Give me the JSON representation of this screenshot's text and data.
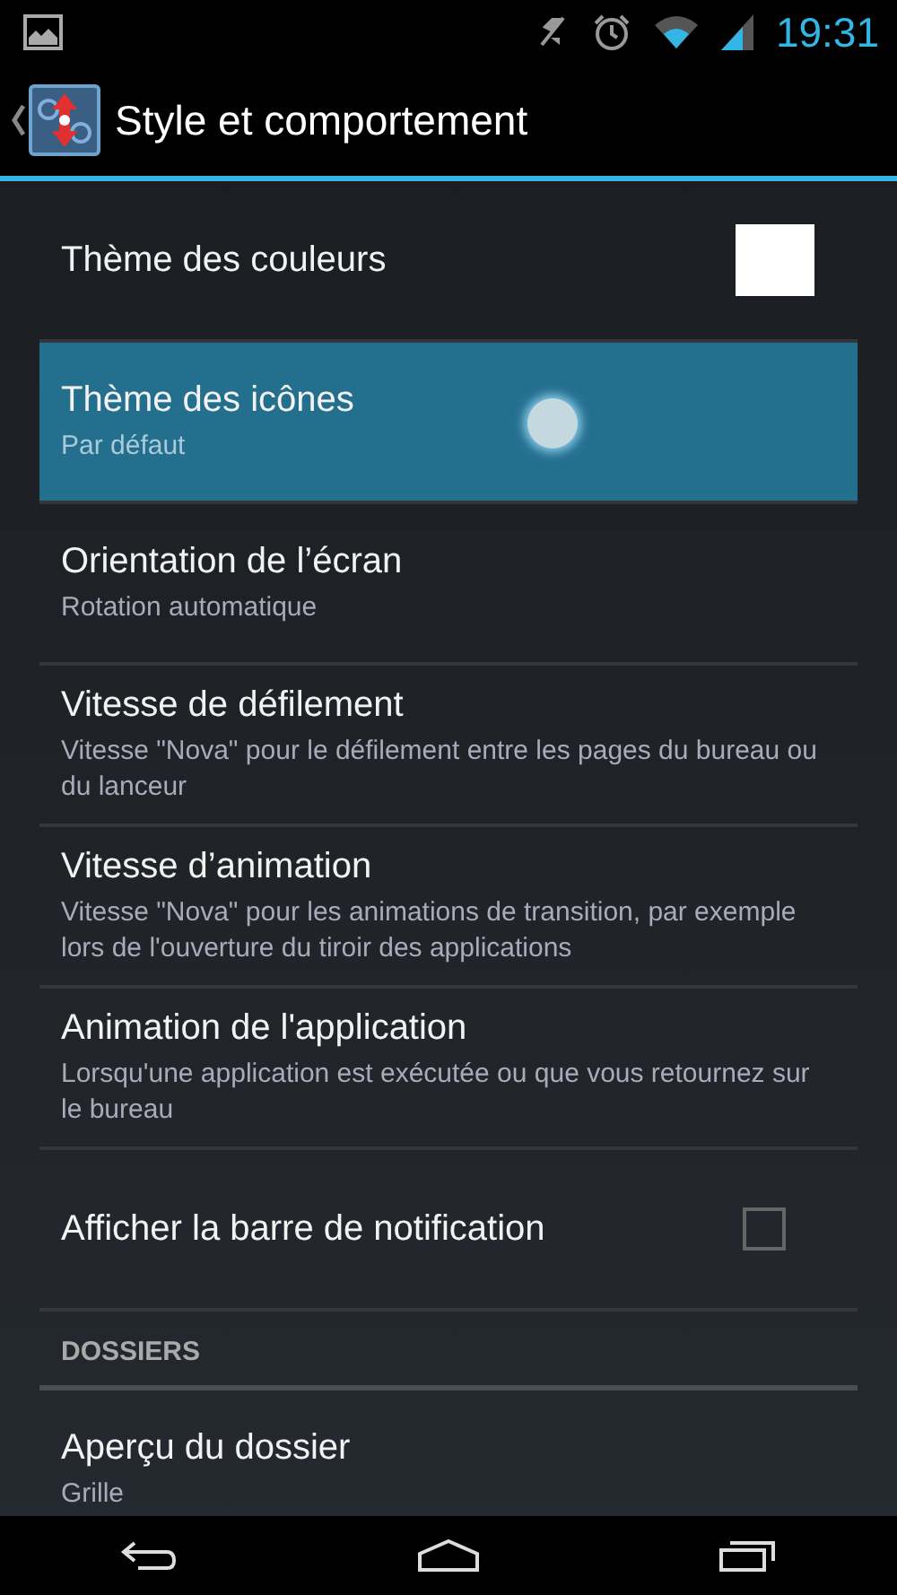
{
  "status_bar": {
    "time": "19:31"
  },
  "action_bar": {
    "title": "Style et comportement"
  },
  "items": [
    {
      "kind": "color",
      "title": "Thème des couleurs",
      "color": "#ffffff",
      "selected": false
    },
    {
      "kind": "list",
      "title": "Thème des icônes",
      "summary": "Par défaut",
      "selected": true
    },
    {
      "kind": "list",
      "title": "Orientation de l’écran",
      "summary": "Rotation automatique",
      "selected": false
    },
    {
      "kind": "list",
      "title": "Vitesse de défilement",
      "summary": "Vitesse \"Nova\" pour le défilement entre les pages du bureau ou du lanceur",
      "selected": false
    },
    {
      "kind": "list",
      "title": "Vitesse d’animation",
      "summary": "Vitesse \"Nova\" pour les animations de transition, par exemple lors de l'ouverture du tiroir des applications",
      "selected": false
    },
    {
      "kind": "list",
      "title": "Animation de l'application",
      "summary": "Lorsqu'une application est exécutée ou que vous retournez sur le bureau",
      "selected": false
    },
    {
      "kind": "checkbox",
      "title": "Afficher la barre de notification",
      "checked": false,
      "selected": false
    },
    {
      "kind": "header",
      "title": "DOSSIERS"
    },
    {
      "kind": "list",
      "title": "Aperçu du dossier",
      "summary": "Grille",
      "selected": false
    }
  ]
}
